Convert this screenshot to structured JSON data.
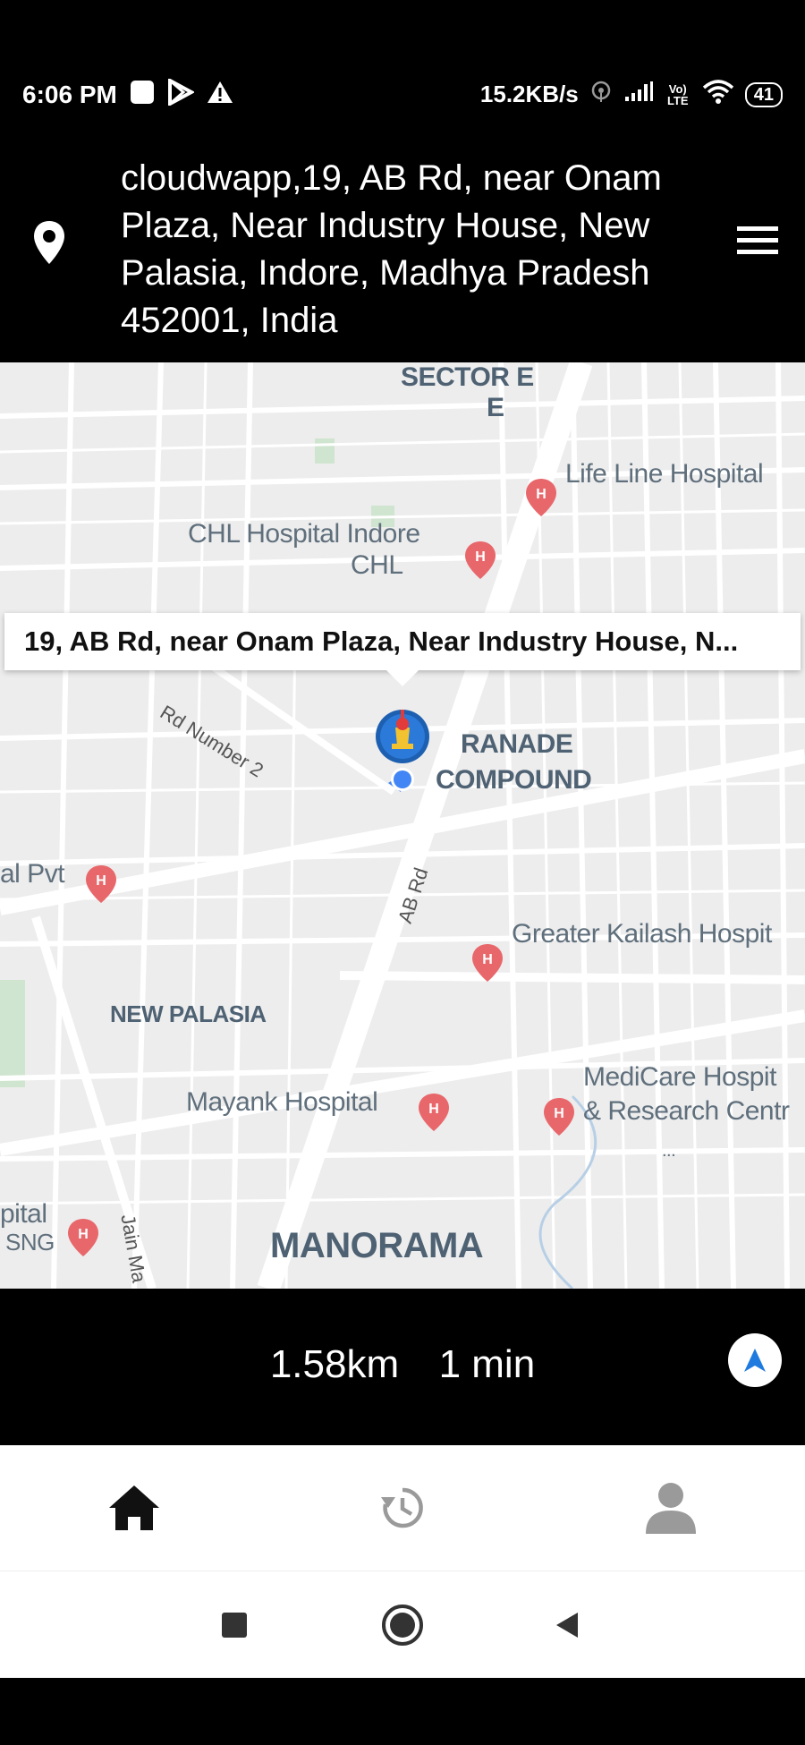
{
  "status_bar": {
    "time": "6:06 PM",
    "speed": "15.2KB/s",
    "network": "Vo) LTE",
    "battery": "41",
    "icons": [
      "square-icon",
      "play-store-icon",
      "warning-icon",
      "hotspot-icon",
      "signal-icon",
      "wifi-icon",
      "battery-icon"
    ]
  },
  "header": {
    "address": "cloudwapp,19, AB Rd, near Onam Plaza, Near Industry House, New Palasia, Indore, Madhya Pradesh 452001, India",
    "pin_icon": "location-pin-icon",
    "menu_icon": "hamburger-menu-icon"
  },
  "map": {
    "callout": "19, AB Rd, near Onam Plaza, Near Industry House, N...",
    "labels": {
      "sector_e": "SECTOR E",
      "sector_e2": "E",
      "life_line": "Life Line Hospital",
      "chl": "CHL Hospital Indore",
      "chl2": "CHL",
      "ranade": "RANADE",
      "compound": "COMPOUND",
      "al_pvt": "al Pvt",
      "greater_kailash": "Greater Kailash Hospit",
      "new_palasia": "NEW PALASIA",
      "medicare1": "MediCare Hospit",
      "medicare2": "& Research Centr",
      "mayank": "Mayank Hospital",
      "pital": "pital",
      "sng": "SNG",
      "manorama": "MANORAMA",
      "rd_number_2": "Rd Number 2",
      "ab_rd": "AB Rd",
      "jain_ma": "Jain Ma",
      "dots": "..."
    },
    "accent_color": "#4285f4",
    "hospital_color": "#e8676b"
  },
  "trip": {
    "distance": "1.58km",
    "duration": "1 min",
    "navigate_icon": "navigation-arrow-icon"
  },
  "tabs": [
    {
      "name": "home",
      "icon": "home-icon"
    },
    {
      "name": "history",
      "icon": "history-icon"
    },
    {
      "name": "profile",
      "icon": "profile-icon"
    }
  ],
  "system_nav": [
    "recents-icon",
    "home-circle-icon",
    "back-icon"
  ]
}
